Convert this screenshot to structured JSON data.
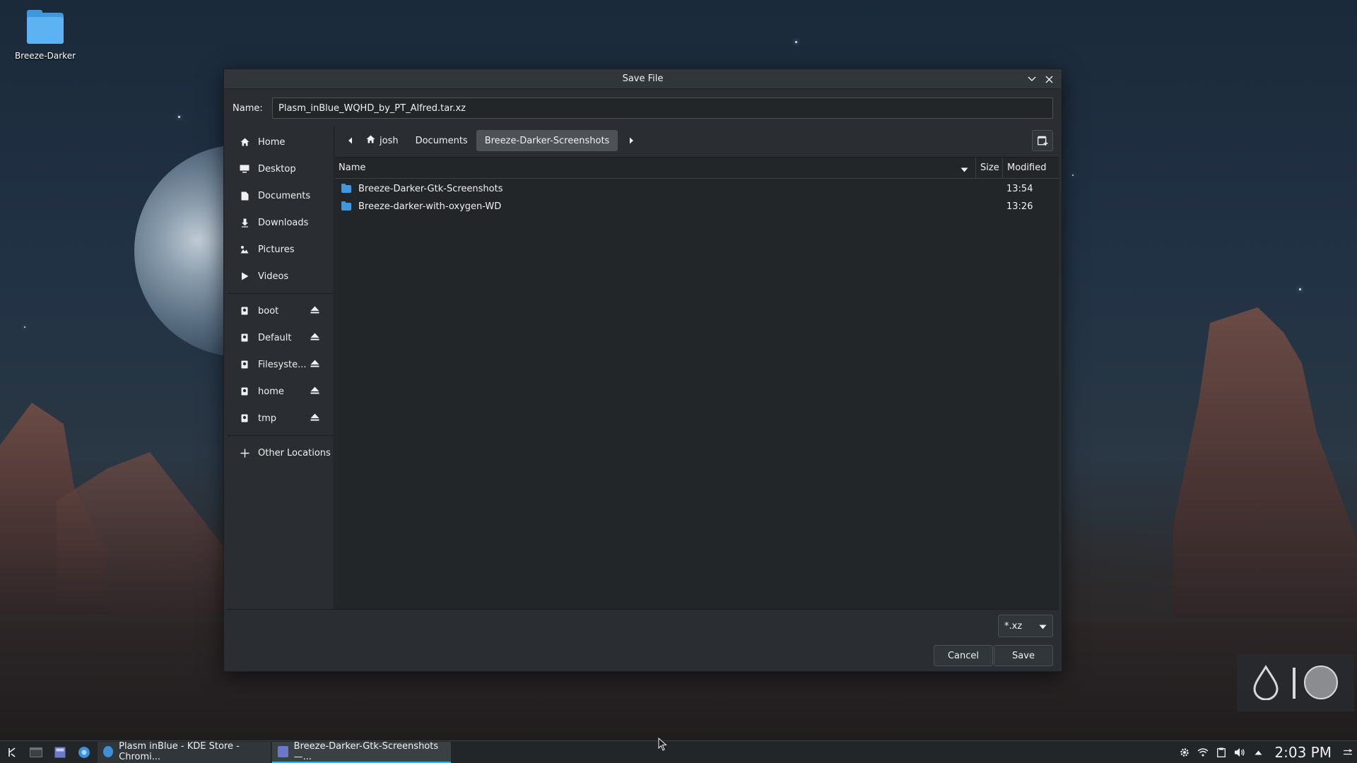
{
  "desktop": {
    "icon_label": "Breeze-Darker"
  },
  "dialog": {
    "title": "Save File",
    "name_label": "Name:",
    "name_value": "Plasm_inBlue_WQHD_by_PT_Alfred.tar.xz",
    "places": [
      {
        "label": "Home",
        "icon": "home-icon"
      },
      {
        "label": "Desktop",
        "icon": "desktop-icon"
      },
      {
        "label": "Documents",
        "icon": "document-icon"
      },
      {
        "label": "Downloads",
        "icon": "download-icon"
      },
      {
        "label": "Pictures",
        "icon": "pictures-icon"
      },
      {
        "label": "Videos",
        "icon": "video-icon"
      }
    ],
    "devices": [
      {
        "label": "boot",
        "icon": "drive-icon"
      },
      {
        "label": "Default",
        "icon": "drive-icon"
      },
      {
        "label": "Filesyste...",
        "icon": "drive-icon"
      },
      {
        "label": "home",
        "icon": "drive-icon"
      },
      {
        "label": "tmp",
        "icon": "drive-icon"
      }
    ],
    "other_locations": "Other Locations",
    "breadcrumb": [
      "josh",
      "Documents",
      "Breeze-Darker-Screenshots"
    ],
    "columns": {
      "name": "Name",
      "size": "Size",
      "modified": "Modified"
    },
    "files": [
      {
        "name": "Breeze-Darker-Gtk-Screenshots",
        "size": "",
        "modified": "13:54"
      },
      {
        "name": "Breeze-darker-with-oxygen-WD",
        "size": "",
        "modified": "13:26"
      }
    ],
    "filter_value": "*.xz",
    "cancel_label": "Cancel",
    "save_label": "Save"
  },
  "taskbar": {
    "tasks": [
      {
        "label": "Plasm inBlue - KDE Store - Chromi..."
      },
      {
        "label": "Breeze-Darker-Gtk-Screenshots —..."
      }
    ],
    "clock": "2:03 PM"
  },
  "colors": {
    "accent": "#3daee9",
    "folder": "#3d98e0",
    "window_bg": "#2a2e32",
    "view_bg": "#232629"
  }
}
